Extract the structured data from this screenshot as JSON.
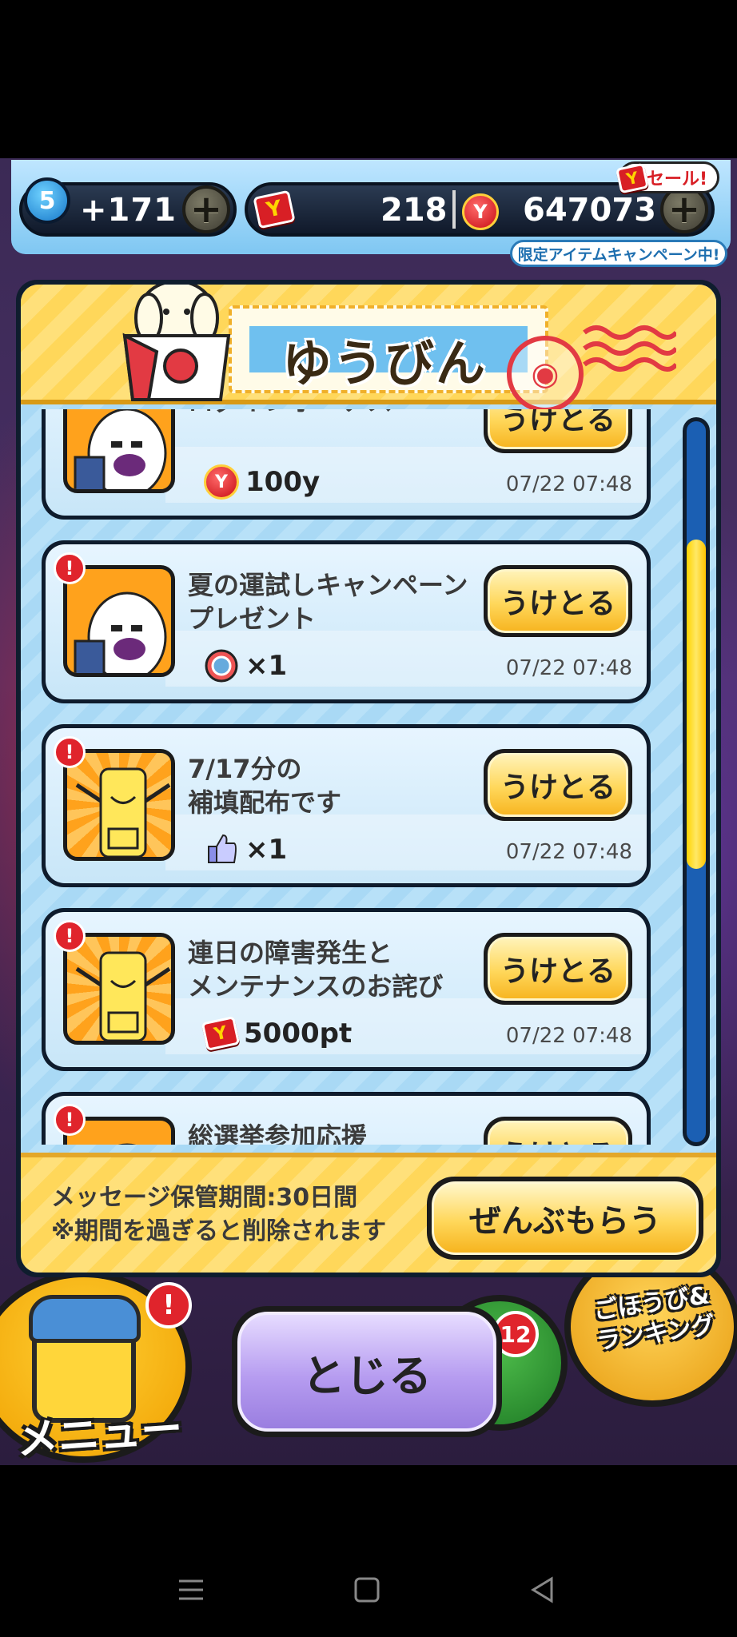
{
  "status_bar": {
    "level": "5",
    "stamina": "+171",
    "points": "218",
    "money": "647073",
    "sale_badge": "セール!",
    "campaign_badge": "限定アイテムキャンペーン中!"
  },
  "mailbox": {
    "title": "ゆうびん",
    "messages": [
      {
        "title": "ログインボーナス",
        "reward_amount": "100y",
        "reward_icon": "yen-coin-icon",
        "date": "07/22 07:48",
        "button": "うけとる"
      },
      {
        "title": "夏の運試しキャンペーン\nプレゼント",
        "reward_amount": "×1",
        "reward_icon": "medal-icon",
        "date": "07/22 07:48",
        "button": "うけとる"
      },
      {
        "title": "7/17分の\n補填配布です",
        "reward_amount": "×1",
        "reward_icon": "thumbs-up-icon",
        "date": "07/22 07:48",
        "button": "うけとる"
      },
      {
        "title": "連日の障害発生と\nメンテナンスのお詫び",
        "reward_amount": "5000pt",
        "reward_icon": "y-ticket-icon",
        "date": "07/22 07:48",
        "button": "うけとる"
      },
      {
        "title": "総選挙参加応援",
        "reward_amount": "",
        "reward_icon": "",
        "date": "",
        "button": "うけとる"
      }
    ],
    "footer_note_line1": "メッセージ保管期間:30日間",
    "footer_note_line2": "※期間を過ぎると削除されます",
    "take_all_button": "ぜんぶもらう"
  },
  "bottom": {
    "menu_label": "メニュー",
    "reward_label_line1": "ごほうび&",
    "reward_label_line2": "ランキング",
    "notification_count": "12",
    "close_button": "とじる"
  },
  "colors": {
    "modal_blue": "#a9d9f5",
    "header_yellow": "#ffd75a",
    "scroll_thumb": "#ffd400",
    "close_purple": "#b69cf0"
  }
}
